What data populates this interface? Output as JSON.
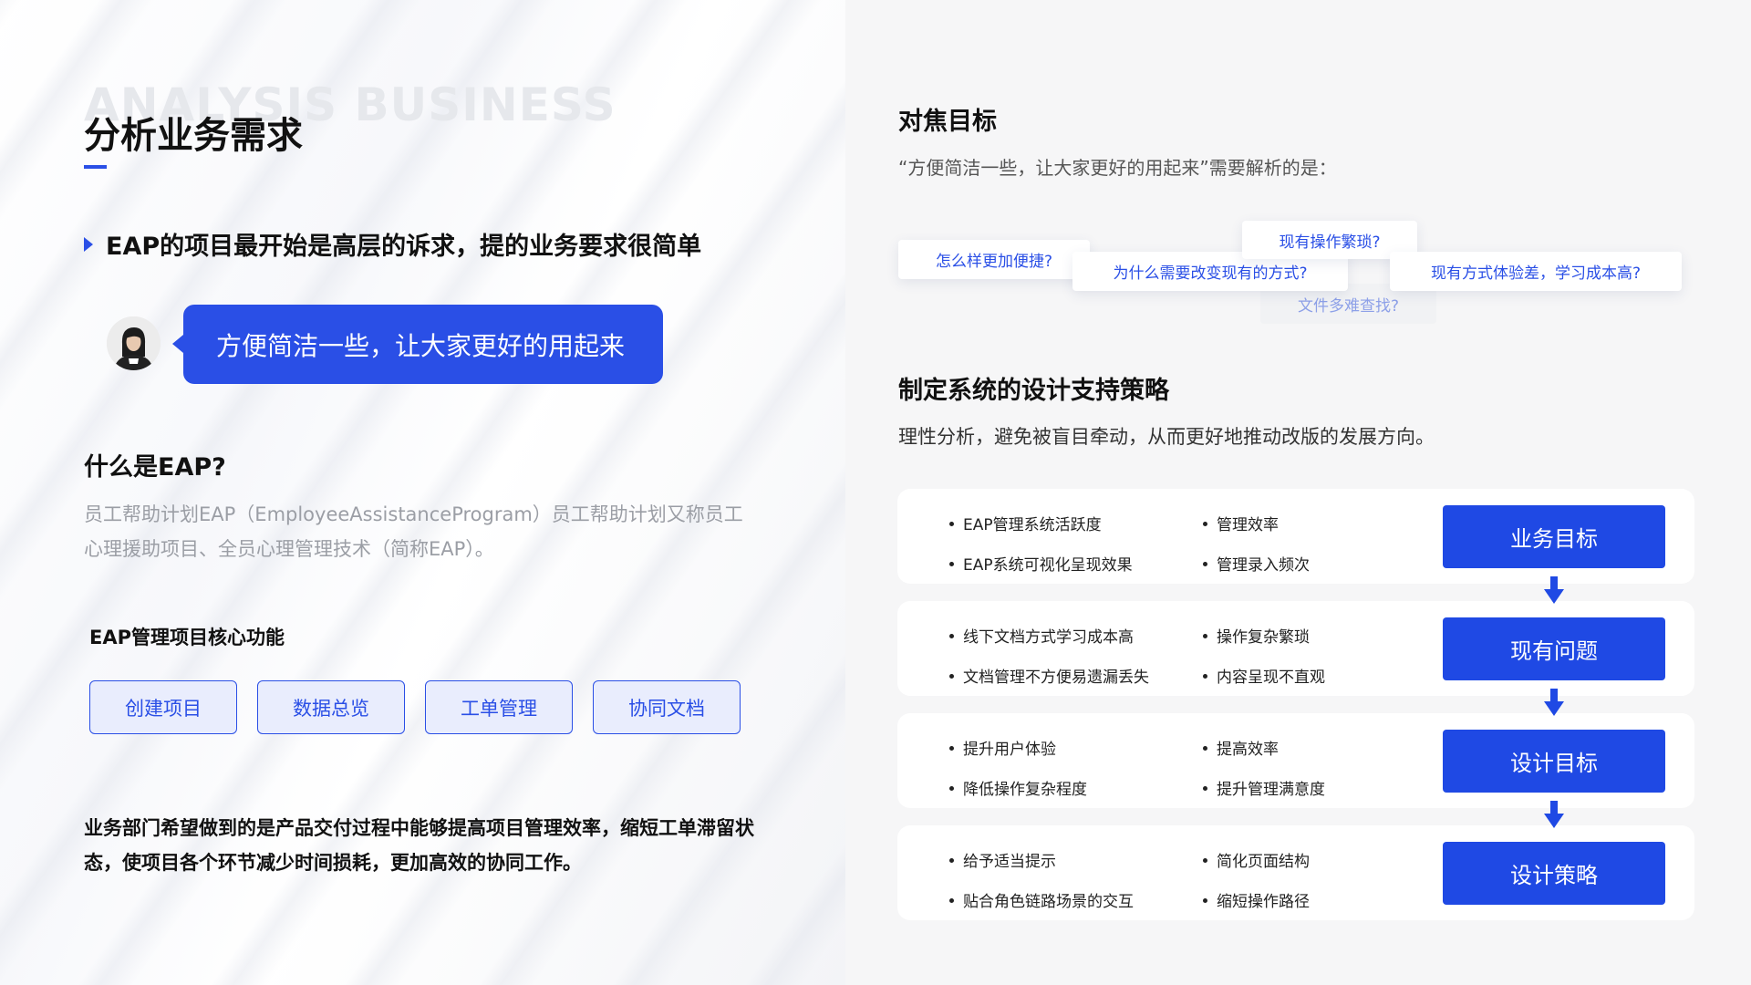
{
  "left": {
    "watermark": "ANALYSIS BUSINESS",
    "title": "分析业务需求",
    "lead": "EAP的项目最开始是高层的诉求，提的业务要求很简单",
    "quote": "方便简洁一些，让大家更好的用起来",
    "what_title": "什么是EAP?",
    "what_desc": "员工帮助计划EAP（EmployeeAssistanceProgram）员工帮助计划又称员工心理援助项目、全员心理管理技术（简称EAP）。",
    "core_title": "EAP管理项目核心功能",
    "functions": [
      "创建项目",
      "数据总览",
      "工单管理",
      "协同文档"
    ],
    "summary": "业务部门希望做到的是产品交付过程中能够提高项目管理效率，缩短工单滞留状态，使项目各个环节减少时间损耗，更加高效的协同工作。"
  },
  "right": {
    "focus_title": "对焦目标",
    "focus_sub": "“方便简洁一些，让大家更好的用起来”需要解析的是：",
    "questions": [
      "怎么样更加便捷?",
      "为什么需要改变现有的方式?",
      "现有操作繁琐?",
      "文件多难查找?",
      "现有方式体验差，学习成本高?"
    ],
    "strategy_title": "制定系统的设计支持策略",
    "strategy_sub": "理性分析，避免被盲目牵动，从而更好地推动改版的发展方向。",
    "rows": [
      {
        "a1": "EAP管理系统活跃度",
        "a2": "EAP系统可视化呈现效果",
        "b1": "管理效率",
        "b2": "管理录入频次",
        "tag": "业务目标"
      },
      {
        "a1": "线下文档方式学习成本高",
        "a2": "文档管理不方便易遗漏丢失",
        "b1": "操作复杂繁琐",
        "b2": "内容呈现不直观",
        "tag": "现有问题"
      },
      {
        "a1": "提升用户体验",
        "a2": "降低操作复杂程度",
        "b1": "提高效率",
        "b2": "提升管理满意度",
        "tag": "设计目标"
      },
      {
        "a1": "给予适当提示",
        "a2": "贴合角色链路场景的交互",
        "b1": "简化页面结构",
        "b2": "缩短操作路径",
        "tag": "设计策略"
      }
    ]
  },
  "colors": {
    "accent": "#2a4fe6",
    "tag_bg": "#1f49e4"
  }
}
